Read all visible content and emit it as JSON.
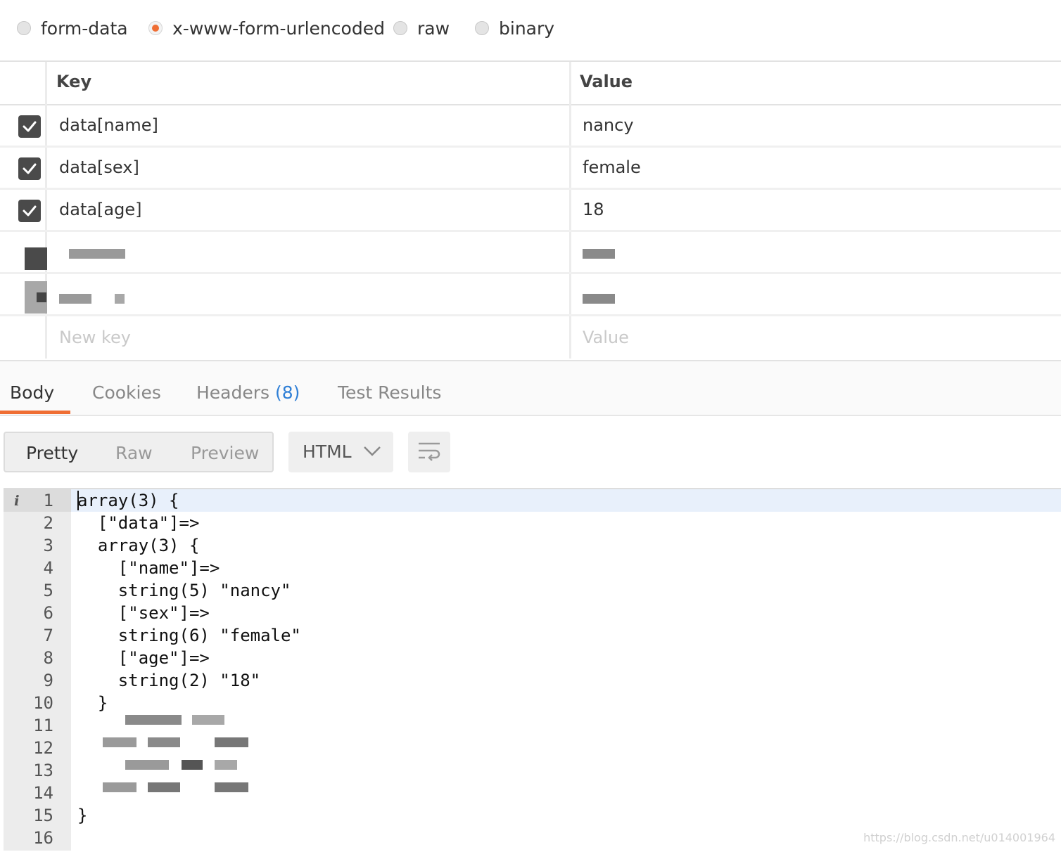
{
  "body_types": [
    {
      "label": "form-data",
      "selected": false
    },
    {
      "label": "x-www-form-urlencoded",
      "selected": true
    },
    {
      "label": "raw",
      "selected": false
    },
    {
      "label": "binary",
      "selected": false
    }
  ],
  "params": {
    "header": {
      "key": "Key",
      "value": "Value"
    },
    "rows": [
      {
        "key": "data[name]",
        "value": "nancy",
        "checked": true
      },
      {
        "key": "data[sex]",
        "value": "female",
        "checked": true
      },
      {
        "key": "data[age]",
        "value": "18",
        "checked": true
      }
    ],
    "new_row": {
      "key_placeholder": "New key",
      "value_placeholder": "Value"
    }
  },
  "response": {
    "tabs": {
      "body": "Body",
      "cookies": "Cookies",
      "headers": "Headers",
      "headers_count": "(8)",
      "test_results": "Test Results"
    },
    "view_modes": {
      "pretty": "Pretty",
      "raw": "Raw",
      "preview": "Preview"
    },
    "format": "HTML",
    "code_lines": [
      "array(3) {",
      "  [\"data\"]=>",
      "  array(3) {",
      "    [\"name\"]=>",
      "    string(5) \"nancy\"",
      "    [\"sex\"]=>",
      "    string(6) \"female\"",
      "    [\"age\"]=>",
      "    string(2) \"18\"",
      "  }",
      "",
      "",
      "",
      "",
      "}",
      ""
    ],
    "line_numbers": [
      "1",
      "2",
      "3",
      "4",
      "5",
      "6",
      "7",
      "8",
      "9",
      "10",
      "11",
      "12",
      "13",
      "14",
      "15",
      "16"
    ]
  },
  "watermark": "https://blog.csdn.net/u014001964",
  "colors": {
    "accent": "#ef6e34",
    "link": "#2f7fd6"
  }
}
